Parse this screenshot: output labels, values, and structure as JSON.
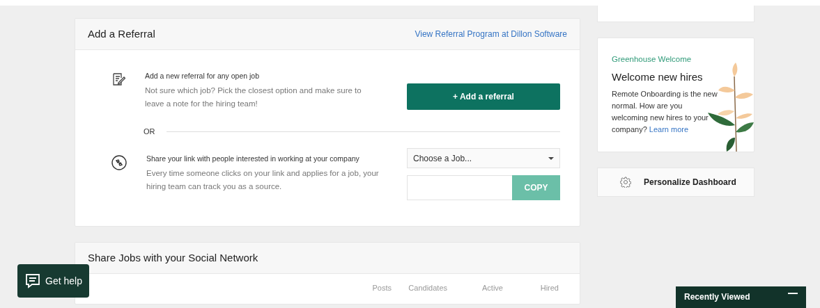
{
  "referral": {
    "title": "Add a Referral",
    "program_link": "View Referral Program at Dillon Software",
    "add": {
      "heading": "Add a new referral for any open job",
      "text": "Not sure which job? Pick the closest option and make sure to leave a note for the hiring team!",
      "button": "+ Add a referral"
    },
    "divider": "OR",
    "share": {
      "heading": "Share your link with people interested in working at your company",
      "text": "Every time someone clicks on your link and applies for a job, your hiring team can track you as a source.",
      "select": "Choose a Job...",
      "copy_button": "COPY"
    }
  },
  "social": {
    "title": "Share Jobs with your Social Network",
    "columns": [
      "Posts",
      "Candidates",
      "Active",
      "Hired"
    ]
  },
  "welcome": {
    "eyebrow": "Greenhouse Welcome",
    "title": "Welcome new hires",
    "text": "Remote Onboarding is the new normal. How are you welcoming new hires to your company?",
    "link": "Learn more"
  },
  "personalize": "Personalize Dashboard",
  "get_help": "Get help",
  "recently_viewed": {
    "title": "Recently Viewed",
    "expanded": true
  }
}
